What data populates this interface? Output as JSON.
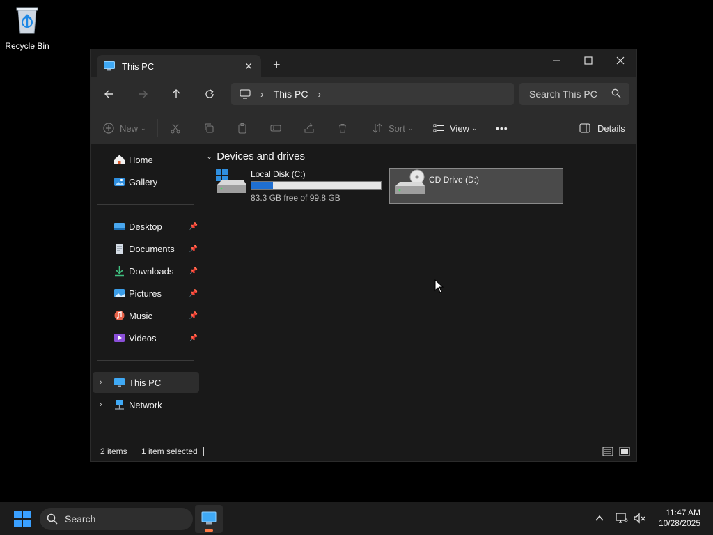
{
  "desktop": {
    "recycle_bin_label": "Recycle Bin"
  },
  "window": {
    "tab_title": "This PC",
    "new_tab_label": "+",
    "controls": {
      "minimize": "—",
      "maximize": "☐",
      "close": "✕"
    }
  },
  "navbar": {
    "breadcrumb": [
      "This PC"
    ],
    "search_placeholder": "Search This PC"
  },
  "toolbar": {
    "new_label": "New",
    "sort_label": "Sort",
    "view_label": "View",
    "more_label": "•••",
    "details_label": "Details"
  },
  "sidebar": {
    "quick": [
      {
        "label": "Home",
        "icon": "home-icon"
      },
      {
        "label": "Gallery",
        "icon": "gallery-icon"
      }
    ],
    "pinned": [
      {
        "label": "Desktop",
        "icon": "desktop-folder-icon",
        "pinned": true
      },
      {
        "label": "Documents",
        "icon": "documents-icon",
        "pinned": true
      },
      {
        "label": "Downloads",
        "icon": "downloads-icon",
        "pinned": true
      },
      {
        "label": "Pictures",
        "icon": "pictures-icon",
        "pinned": true
      },
      {
        "label": "Music",
        "icon": "music-icon",
        "pinned": true
      },
      {
        "label": "Videos",
        "icon": "videos-icon",
        "pinned": true
      }
    ],
    "locations": [
      {
        "label": "This PC",
        "icon": "this-pc-icon",
        "selected": true
      },
      {
        "label": "Network",
        "icon": "network-icon",
        "selected": false
      }
    ]
  },
  "content": {
    "group_title": "Devices and drives",
    "drives": [
      {
        "name": "Local Disk (C:)",
        "free_text": "83.3 GB free of 99.8 GB",
        "used_fraction": 0.165,
        "selected": false
      },
      {
        "name": "CD Drive (D:)",
        "free_text": "",
        "selected": true
      }
    ]
  },
  "status": {
    "item_count": "2 items",
    "selection": "1 item selected"
  },
  "taskbar": {
    "search_label": "Search",
    "time": "11:47 AM",
    "date": "10/28/2025"
  },
  "colors": {
    "accent": "#1f6fd1",
    "window_bg": "#191919",
    "bar_bg": "#2c2c2c",
    "taskbar_indicator": "#ff7a45"
  }
}
